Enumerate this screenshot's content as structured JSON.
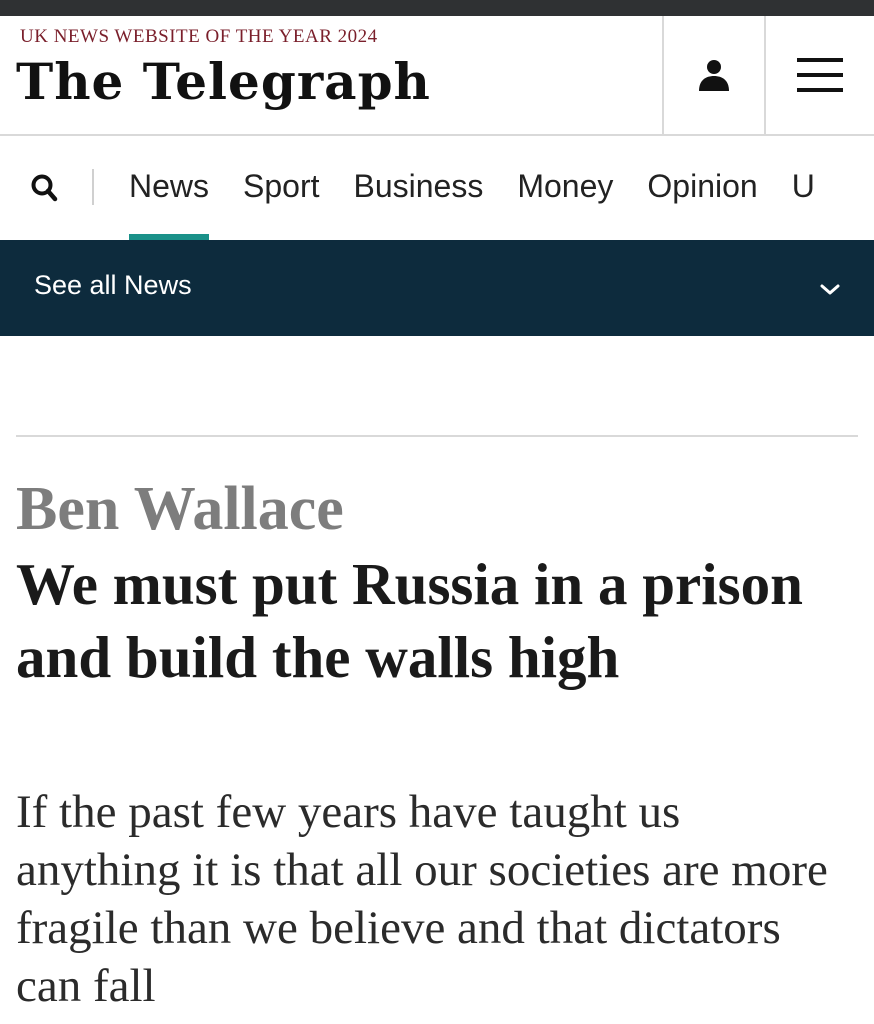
{
  "header": {
    "award": "UK NEWS WEBSITE OF THE YEAR 2024",
    "logo": "The Telegraph",
    "account_icon": "person-icon",
    "menu_icon": "hamburger-menu-icon"
  },
  "nav": {
    "search_icon": "search-icon",
    "items": [
      {
        "label": "News",
        "active": true
      },
      {
        "label": "Sport",
        "active": false
      },
      {
        "label": "Business",
        "active": false
      },
      {
        "label": "Money",
        "active": false
      },
      {
        "label": "Opinion",
        "active": false
      },
      {
        "label": "U",
        "active": false
      }
    ],
    "active_color": "#1a9189"
  },
  "subnav": {
    "label": "See all News",
    "icon": "chevron-down-icon",
    "background": "#0d2b3d"
  },
  "article": {
    "byline": "Ben Wallace",
    "headline": "We must put Russia in a prison and build the walls high",
    "standfirst": "If the past few years have taught us anything it is that all our societies are more fragile than we believe and that dictators can fall"
  }
}
